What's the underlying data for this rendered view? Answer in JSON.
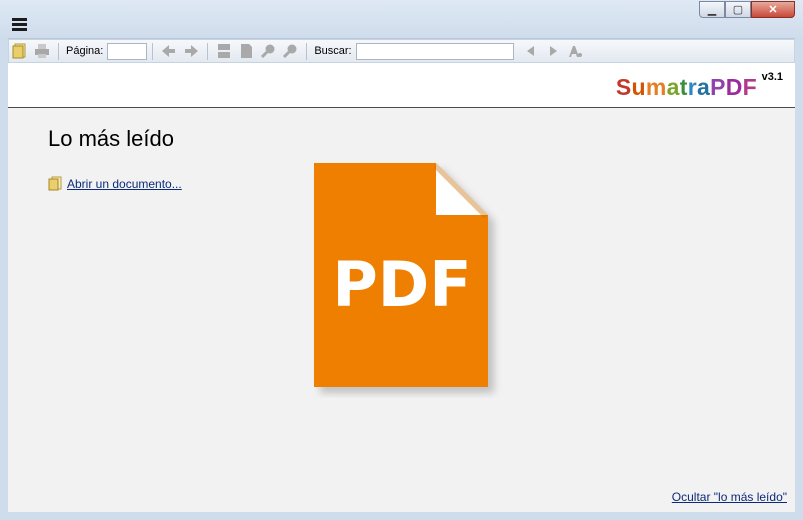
{
  "toolbar": {
    "page_label": "Página:",
    "page_value": "",
    "search_label": "Buscar:",
    "search_value": ""
  },
  "logo": {
    "letters": [
      {
        "ch": "S",
        "color": "#c0392b"
      },
      {
        "ch": "u",
        "color": "#d35400"
      },
      {
        "ch": "m",
        "color": "#e67e22"
      },
      {
        "ch": "a",
        "color": "#7aa42a"
      },
      {
        "ch": "t",
        "color": "#3e8e41"
      },
      {
        "ch": "r",
        "color": "#2e86c1"
      },
      {
        "ch": "a",
        "color": "#2471a3"
      },
      {
        "ch": "P",
        "color": "#8e44ad"
      },
      {
        "ch": "D",
        "color": "#9b2d9b"
      },
      {
        "ch": "F",
        "color": "#b03a8a"
      }
    ],
    "version": "v3.1"
  },
  "main": {
    "heading": "Lo más leído",
    "open_link": "Abrir un documento...",
    "hide_link": "Ocultar \"lo más leído\"",
    "pdf_icon_label": "PDF"
  },
  "colors": {
    "pdf_orange": "#ef7f00",
    "link": "#0c2a7a"
  }
}
